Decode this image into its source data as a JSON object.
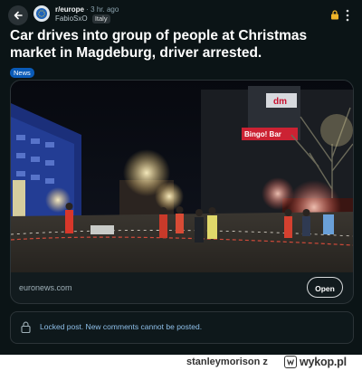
{
  "post": {
    "subreddit": "r/europe",
    "separator": "·",
    "age": "3 hr. ago",
    "author": "FabioSxO",
    "flair": "Italy",
    "title": "Car drives into group of people at Christmas market in Magdeburg, driver arrested.",
    "tag": "News"
  },
  "link_card": {
    "domain": "euronews.com",
    "open_label": "Open",
    "image_signs": {
      "store_sign": "dm",
      "stall_sign": "Bingo! Bar"
    }
  },
  "locked_notice": "Locked post. New comments cannot be posted.",
  "watermark": {
    "author": "stanleymorison",
    "source": "z",
    "site": "wykop.pl"
  },
  "colors": {
    "background": "#0b1416",
    "tag": "#0a5bb8",
    "lock_icon": "#f0b429",
    "notice_text": "#8fc0ea"
  },
  "icons": {
    "back": "back-arrow-icon",
    "lock": "lock-icon",
    "more": "more-vertical-icon",
    "subreddit_avatar": "subreddit-avatar-icon"
  }
}
